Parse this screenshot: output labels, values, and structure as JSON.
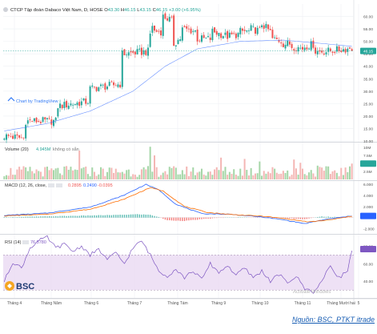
{
  "header": {
    "symbol_text": "CTCP Tập đoàn Dabaco Việt Nam, D, HOSE",
    "ohlc": [
      {
        "label": "O",
        "value": "43.30"
      },
      {
        "label": "H",
        "value": "46.15"
      },
      {
        "label": "L",
        "value": "43.15"
      },
      {
        "label": "C",
        "value": "46.15"
      }
    ],
    "change_text": "+3.00 (+6.95%)"
  },
  "watermark": {
    "chart_by": "Chart by TradingView",
    "activate": "Activate Windows"
  },
  "logo": {
    "text": "BSC"
  },
  "source": {
    "text": "Nguồn: BSC, PTKT itrade"
  },
  "colors": {
    "up": "#26a69a",
    "down": "#ef5350",
    "vol_up": "#a5d6a7",
    "vol_down": "#f4b6b4",
    "macd_line": "#2962ff",
    "signal_line": "#ff6d00",
    "rsi_line": "#7e57c2",
    "rsi_band": "#ead9f2",
    "ma_line": "#2962ff",
    "last_price_bg": "#26a69a"
  },
  "chart_data": [
    {
      "type": "candlestick",
      "title": "CTCP Tập đoàn Dabaco Việt Nam, D, HOSE",
      "ylim": [
        10,
        65
      ],
      "yticks": [
        "60.00",
        "55.00",
        "50.00",
        "45.00",
        "40.00",
        "35.00",
        "30.00",
        "25.00",
        "20.00",
        "15.00",
        "10.00"
      ],
      "last_price": "46.15",
      "last_value": 46.15,
      "xticks": [
        "Tháng 4",
        "Tháng Năm",
        "Tháng 6",
        "Tháng 7",
        "Tháng Tám",
        "Tháng 9",
        "Tháng 10",
        "Tháng 11",
        "Tháng Mười hai",
        "5"
      ],
      "segments": [
        [
          0,
          12,
          11
        ],
        [
          10,
          18,
          18
        ],
        [
          25,
          24,
          26
        ],
        [
          40,
          31,
          33
        ],
        [
          55,
          45,
          46
        ],
        [
          68,
          53,
          60
        ],
        [
          70,
          54,
          54
        ],
        [
          74,
          60,
          58
        ],
        [
          79,
          49,
          52
        ],
        [
          83,
          55,
          54
        ],
        [
          90,
          51,
          51
        ],
        [
          97,
          54,
          52
        ],
        [
          104,
          52,
          53
        ],
        [
          110,
          54,
          54
        ],
        [
          115,
          55,
          54
        ],
        [
          120,
          57,
          53
        ],
        [
          125,
          51,
          50
        ],
        [
          130,
          49,
          49
        ],
        [
          134,
          48,
          47
        ],
        [
          140,
          48,
          49
        ],
        [
          145,
          46,
          46
        ],
        [
          150,
          46,
          47
        ],
        [
          160,
          47,
          48
        ],
        [
          162,
          47,
          46
        ]
      ],
      "ma": [
        [
          0,
          14
        ],
        [
          20,
          17
        ],
        [
          40,
          22
        ],
        [
          60,
          30
        ],
        [
          75,
          40
        ],
        [
          90,
          47
        ],
        [
          110,
          50
        ],
        [
          130,
          50.5
        ],
        [
          150,
          49
        ],
        [
          162,
          48
        ]
      ]
    },
    {
      "type": "bar",
      "title": "Volume (20)",
      "legend": [
        "4.945M",
        "không có sẵn"
      ],
      "yticks": [
        "10M",
        "7.5M",
        "5M",
        "2.5M"
      ],
      "ylim": [
        0,
        11
      ],
      "last_value": 4.945,
      "base_level": 2.0,
      "spikes": [
        [
          35,
          9.0
        ],
        [
          68,
          10.2
        ],
        [
          70,
          7.5
        ],
        [
          101,
          6.8
        ],
        [
          112,
          6.4
        ],
        [
          119,
          5.6
        ],
        [
          135,
          6.2
        ],
        [
          138,
          5.2
        ],
        [
          146,
          4.3
        ],
        [
          150,
          4.1
        ],
        [
          162,
          4.945
        ]
      ]
    },
    {
      "type": "line",
      "title": "MACD (12, 26, close, 9)",
      "legend_values": [
        "0.2895",
        "0.2490",
        "-0.0395"
      ],
      "yticks": [
        "6.000",
        "4.000",
        "2.000",
        "0.000",
        "-2.000"
      ],
      "ylim": [
        -2.8,
        6.6
      ],
      "series": [
        {
          "line": "macd",
          "keypoints": [
            [
              0,
              0.4
            ],
            [
              20,
              0.8
            ],
            [
              40,
              1.9
            ],
            [
              55,
              3.9
            ],
            [
              66,
              6.0
            ],
            [
              72,
              5.0
            ],
            [
              80,
              2.4
            ],
            [
              92,
              0.7
            ],
            [
              105,
              0.6
            ],
            [
              120,
              0.1
            ],
            [
              130,
              -0.4
            ],
            [
              140,
              -1.1
            ],
            [
              150,
              -0.3
            ],
            [
              162,
              0.29
            ]
          ]
        },
        {
          "line": "signal",
          "keypoints": [
            [
              0,
              0.3
            ],
            [
              20,
              0.6
            ],
            [
              40,
              1.5
            ],
            [
              55,
              3.2
            ],
            [
              68,
              5.4
            ],
            [
              74,
              4.8
            ],
            [
              84,
              2.0
            ],
            [
              95,
              0.9
            ],
            [
              108,
              0.5
            ],
            [
              122,
              0.2
            ],
            [
              133,
              -0.3
            ],
            [
              142,
              -0.8
            ],
            [
              152,
              -0.4
            ],
            [
              162,
              0.25
            ]
          ]
        }
      ],
      "histogram": [
        [
          0,
          0.05
        ],
        [
          55,
          0.5
        ],
        [
          62,
          0.6
        ],
        [
          68,
          0.5
        ],
        [
          72,
          0.1
        ],
        [
          76,
          -0.5
        ],
        [
          84,
          -0.6
        ],
        [
          92,
          -0.3
        ],
        [
          100,
          -0.05
        ],
        [
          110,
          0.05
        ],
        [
          120,
          -0.05
        ],
        [
          130,
          -0.1
        ],
        [
          140,
          -0.3
        ],
        [
          148,
          0.2
        ],
        [
          162,
          -0.04
        ]
      ]
    },
    {
      "type": "line",
      "title": "RSI (14)",
      "legend": [
        "76.5780"
      ],
      "yticks": [
        "80.00",
        "60.00",
        "40.00"
      ],
      "ylim": [
        22,
        93
      ],
      "band": [
        30,
        70
      ],
      "series": [
        {
          "line": "rsi",
          "keypoints": [
            [
              0,
              40
            ],
            [
              4,
              62
            ],
            [
              8,
              55
            ],
            [
              12,
              78
            ],
            [
              16,
              86
            ],
            [
              20,
              90
            ],
            [
              24,
              78
            ],
            [
              28,
              82
            ],
            [
              32,
              74
            ],
            [
              36,
              80
            ],
            [
              40,
              70
            ],
            [
              44,
              76
            ],
            [
              48,
              65
            ],
            [
              52,
              72
            ],
            [
              56,
              60
            ],
            [
              60,
              78
            ],
            [
              64,
              86
            ],
            [
              68,
              70
            ],
            [
              72,
              52
            ],
            [
              76,
              46
            ],
            [
              80,
              54
            ],
            [
              84,
              44
            ],
            [
              88,
              52
            ],
            [
              92,
              42
            ],
            [
              96,
              60
            ],
            [
              100,
              50
            ],
            [
              104,
              58
            ],
            [
              108,
              47
            ],
            [
              112,
              55
            ],
            [
              116,
              44
            ],
            [
              120,
              52
            ],
            [
              124,
              40
            ],
            [
              128,
              48
            ],
            [
              132,
              38
            ],
            [
              136,
              46
            ],
            [
              140,
              32
            ],
            [
              144,
              28
            ],
            [
              148,
              40
            ],
            [
              152,
              58
            ],
            [
              156,
              44
            ],
            [
              160,
              52
            ],
            [
              162,
              76.6
            ]
          ]
        }
      ]
    }
  ]
}
